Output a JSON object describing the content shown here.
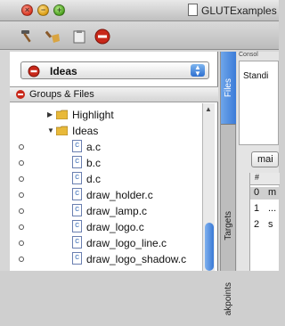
{
  "window": {
    "title": "GLUTExamples"
  },
  "toolbar": {
    "icons": [
      "hammer-icon",
      "broom-icon",
      "clipboard-icon",
      "stop-icon"
    ]
  },
  "project_popup": {
    "selected": "Ideas"
  },
  "groups_header": {
    "label": "Groups & Files"
  },
  "tree": {
    "rows": [
      {
        "label": "Highlight",
        "kind": "folder",
        "expanded": false
      },
      {
        "label": "Ideas",
        "kind": "folder",
        "expanded": true
      },
      {
        "label": "a.c",
        "kind": "file"
      },
      {
        "label": "b.c",
        "kind": "file"
      },
      {
        "label": "d.c",
        "kind": "file"
      },
      {
        "label": "draw_holder.c",
        "kind": "file"
      },
      {
        "label": "draw_lamp.c",
        "kind": "file"
      },
      {
        "label": "draw_logo.c",
        "kind": "file"
      },
      {
        "label": "draw_logo_line.c",
        "kind": "file"
      },
      {
        "label": "draw_logo_shadow.c",
        "kind": "file"
      }
    ]
  },
  "side_tabs": {
    "files": "Files",
    "targets": "Targets",
    "breakpoints": "akpoints"
  },
  "console": {
    "title": "Consol",
    "text": "Standi"
  },
  "right_popup": {
    "value": "mai"
  },
  "stack": {
    "header": "#",
    "rows": [
      {
        "num": "0",
        "fn": "m"
      },
      {
        "num": "1",
        "fn": "..."
      },
      {
        "num": "2",
        "fn": "s"
      }
    ]
  },
  "colors": {
    "selection_blue": "#3b7bd8",
    "stop_red": "#d6331f"
  }
}
